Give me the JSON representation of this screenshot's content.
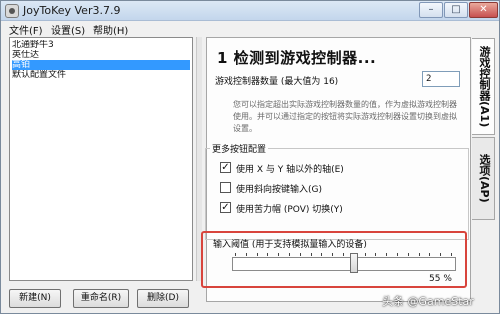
{
  "window": {
    "title": "JoyToKey Ver3.7.9",
    "controls": {
      "minimize": "–",
      "maximize": "□",
      "close": "✕"
    }
  },
  "menu": [
    "文件(F)",
    "设置(S)",
    "帮助(H)"
  ],
  "profiles": {
    "items": [
      "北通野牛3",
      "英仕达",
      "高铂",
      "默认配置文件"
    ],
    "selected_index": 2
  },
  "buttons": {
    "new": "新建(N)",
    "rename": "重命名(R)",
    "delete": "删除(D)"
  },
  "panel": {
    "heading": "1 检测到游戏控制器...",
    "controller_count_label": "游戏控制器数量 (最大值为 16)",
    "controller_count_value": "2",
    "description": "您可以指定超出实际游戏控制器数量的值，作为虚拟游戏控制器使用。并可以通过指定的按钮将实际游戏控制器设置切换到虚拟设置。"
  },
  "more_buttons": {
    "title": "更多按钮配置",
    "options": [
      {
        "label": "使用 X 与 Y 轴以外的轴(E)",
        "checked": true
      },
      {
        "label": "使用斜向按键输入(G)",
        "checked": false
      },
      {
        "label": "使用苦力帽 (POV) 切换(Y)",
        "checked": true
      }
    ]
  },
  "threshold": {
    "label": "输入阈值 (用于支持模拟量输入的设备)",
    "value_percent": 55,
    "display": "55 %"
  },
  "tabs": [
    "游戏控制器(A1)",
    "选项(AP)"
  ],
  "watermark": "头条 @GameStar",
  "colors": {
    "selection": "#3399ff",
    "highlight_frame": "#d8443c",
    "description_text": "#6b6b6b"
  }
}
